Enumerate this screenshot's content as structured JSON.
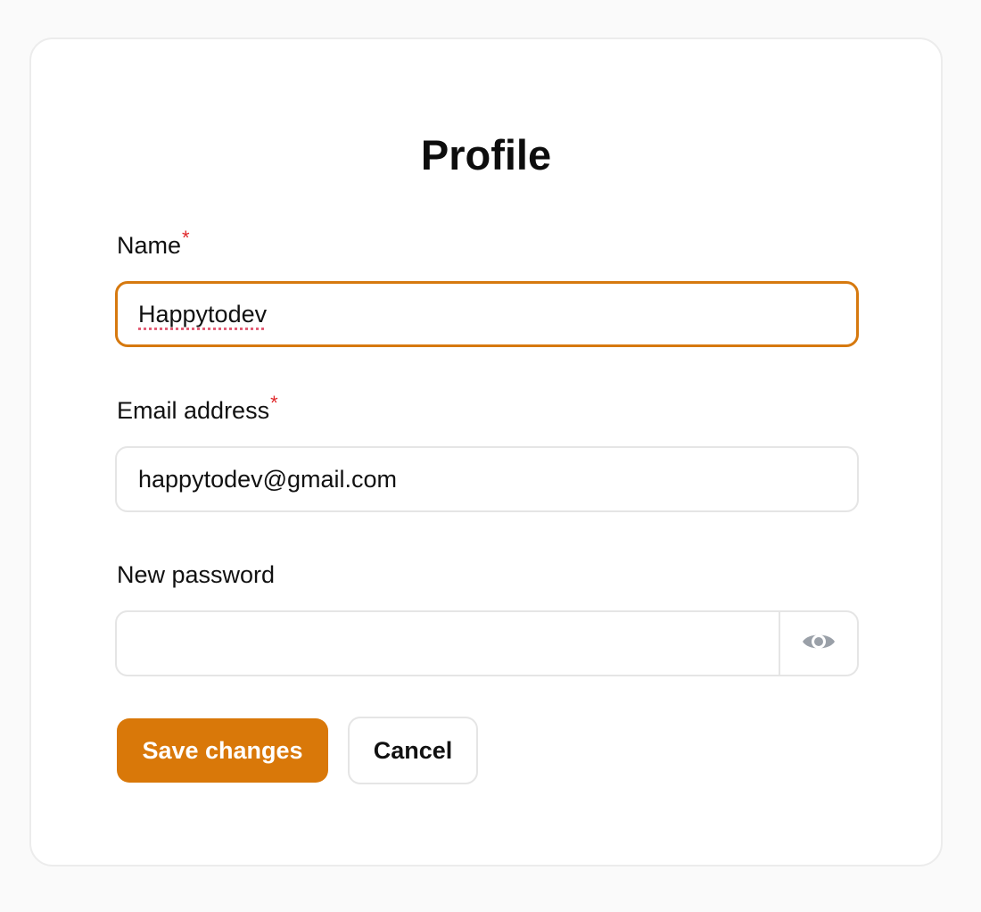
{
  "form": {
    "title": "Profile",
    "required_marker": "*",
    "name": {
      "label": "Name",
      "value": "Happytodev",
      "required": true
    },
    "email": {
      "label": "Email address",
      "value": "happytodev@gmail.com",
      "required": true
    },
    "password": {
      "label": "New password",
      "value": "",
      "toggle_icon": "eye-icon"
    },
    "actions": {
      "save_label": "Save changes",
      "cancel_label": "Cancel"
    }
  },
  "colors": {
    "accent": "#d97809",
    "focus_border": "#d6790f",
    "required": "#e0282b",
    "border": "#e5e5e5",
    "page_background": "#fafafa"
  }
}
